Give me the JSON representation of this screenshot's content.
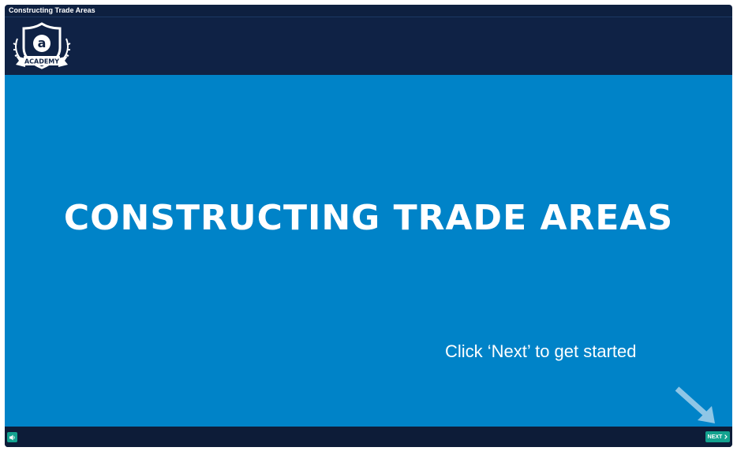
{
  "window": {
    "title": "Constructing Trade Areas"
  },
  "header": {
    "logo_letter": "a",
    "logo_text": "ACADEMY"
  },
  "slide": {
    "title": "CONSTRUCTING TRADE AREAS",
    "instruction": "Click ‘Next’ to get started",
    "arrow_icon": "arrow-down-right-icon"
  },
  "footer": {
    "audio_icon": "speaker-icon",
    "next_label": "NEXT",
    "next_icon": "chevron-right-icon"
  },
  "colors": {
    "frame": "#0e2040",
    "slide_bg": "#0083c8",
    "button": "#13a28f",
    "arrow": "#8fc6e6"
  }
}
